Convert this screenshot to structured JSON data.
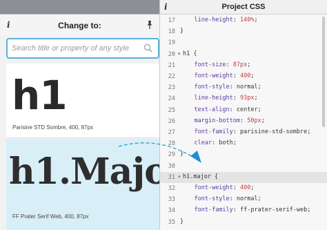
{
  "left_panel": {
    "title": "Change to:",
    "info_icon": "i",
    "search": {
      "placeholder": "Search title or property of any style",
      "value": ""
    },
    "styles": [
      {
        "sample": "h1",
        "caption": "Parisine STD Sombre, 400, 87px",
        "selected": false
      },
      {
        "sample": "h1.Major",
        "caption": "FF Prater Serif Web, 400, 87px",
        "selected": true
      }
    ]
  },
  "right_panel": {
    "title": "Project CSS",
    "info_icon": "i",
    "lines": [
      {
        "n": "17",
        "text": "    line-height: 140%;",
        "fold": false,
        "highlight": false
      },
      {
        "n": "18",
        "text": "}",
        "fold": false,
        "highlight": false
      },
      {
        "n": "19",
        "text": "",
        "fold": false,
        "highlight": false
      },
      {
        "n": "20",
        "text": "h1 {",
        "fold": true,
        "highlight": false
      },
      {
        "n": "21",
        "text": "    font-size: 87px;",
        "fold": false,
        "highlight": false
      },
      {
        "n": "22",
        "text": "    font-weight: 400;",
        "fold": false,
        "highlight": false
      },
      {
        "n": "23",
        "text": "    font-style: normal;",
        "fold": false,
        "highlight": false
      },
      {
        "n": "24",
        "text": "    line-height: 93px;",
        "fold": false,
        "highlight": false
      },
      {
        "n": "25",
        "text": "    text-align: center;",
        "fold": false,
        "highlight": false
      },
      {
        "n": "26",
        "text": "    margin-bottom: 50px;",
        "fold": false,
        "highlight": false
      },
      {
        "n": "27",
        "text": "    font-family: parisine-std-sombre;",
        "fold": false,
        "highlight": false
      },
      {
        "n": "28",
        "text": "    clear: both;",
        "fold": false,
        "highlight": false
      },
      {
        "n": "29",
        "text": "}",
        "fold": false,
        "highlight": false
      },
      {
        "n": "30",
        "text": "",
        "fold": false,
        "highlight": false
      },
      {
        "n": "31",
        "text": "h1.major {",
        "fold": true,
        "highlight": true
      },
      {
        "n": "32",
        "text": "    font-weight: 400;",
        "fold": false,
        "highlight": false
      },
      {
        "n": "33",
        "text": "    font-style: normal;",
        "fold": false,
        "highlight": false
      },
      {
        "n": "34",
        "text": "    font-family: ff-prater-serif-web;",
        "fold": false,
        "highlight": false
      },
      {
        "n": "35",
        "text": "}",
        "fold": false,
        "highlight": false
      }
    ]
  },
  "icons": {
    "info": "info-icon",
    "pin": "pin-icon",
    "search": "search-icon",
    "fold": "fold-arrow-icon",
    "drag": "drag-arrow-icon"
  },
  "colors": {
    "search_border": "#5ab0da",
    "selected_item_bg": "#d9eff8",
    "css_property": "#5a3aa0",
    "css_number": "#c04040",
    "drag_arrow": "#3aa0d0"
  }
}
